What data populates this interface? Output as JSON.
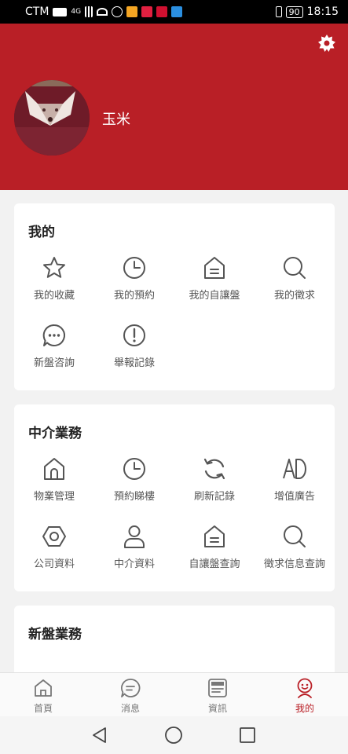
{
  "status": {
    "carrier": "CTM",
    "network": "4G",
    "battery": "90",
    "time": "18:15"
  },
  "profile": {
    "name": "玉米"
  },
  "colors": {
    "brand": "#b91f26",
    "icon": "#555555"
  },
  "sections": [
    {
      "title": "我的",
      "items": [
        {
          "label": "我的收藏",
          "icon": "star-icon"
        },
        {
          "label": "我的預約",
          "icon": "clock-icon"
        },
        {
          "label": "我的自讓盤",
          "icon": "house-doc-icon"
        },
        {
          "label": "我的徵求",
          "icon": "search-icon"
        },
        {
          "label": "新盤咨詢",
          "icon": "chat-bubble-icon"
        },
        {
          "label": "舉報記錄",
          "icon": "exclamation-icon"
        }
      ]
    },
    {
      "title": "中介業務",
      "items": [
        {
          "label": "物業管理",
          "icon": "home-icon"
        },
        {
          "label": "預約睇樓",
          "icon": "clock-icon"
        },
        {
          "label": "刷新記錄",
          "icon": "refresh-icon"
        },
        {
          "label": "增值廣告",
          "icon": "ad-icon"
        },
        {
          "label": "公司資料",
          "icon": "hexagon-icon"
        },
        {
          "label": "中介資料",
          "icon": "person-icon"
        },
        {
          "label": "自讓盤查詢",
          "icon": "house-doc-icon"
        },
        {
          "label": "徵求信息查詢",
          "icon": "search-icon"
        }
      ]
    },
    {
      "title": "新盤業務",
      "items": []
    }
  ],
  "tabbar": [
    {
      "label": "首頁",
      "icon": "home-icon",
      "active": false
    },
    {
      "label": "消息",
      "icon": "message-icon",
      "active": false
    },
    {
      "label": "資訊",
      "icon": "news-icon",
      "active": false
    },
    {
      "label": "我的",
      "icon": "profile-face-icon",
      "active": true
    }
  ]
}
